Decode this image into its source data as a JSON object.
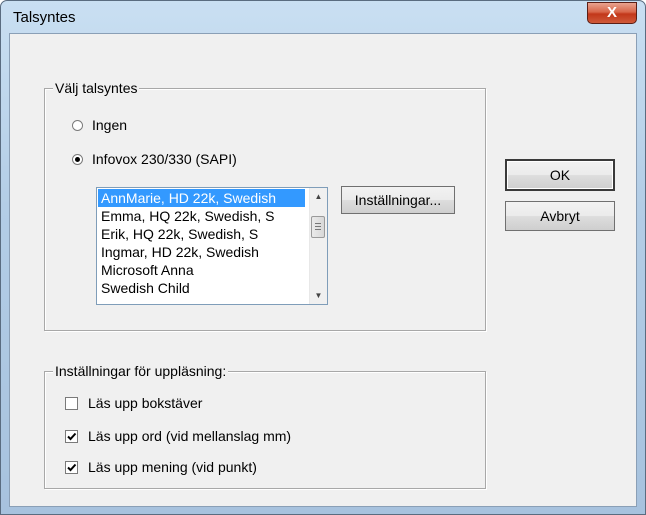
{
  "window": {
    "title": "Talsyntes",
    "close_glyph": "X"
  },
  "engine_group": {
    "label": "Välj talsyntes",
    "radio_none": {
      "label": "Ingen",
      "checked": false
    },
    "radio_infovox": {
      "label": "Infovox 230/330 (SAPI)",
      "checked": true
    },
    "voices": [
      {
        "label": "AnnMarie, HD 22k, Swedish",
        "selected": true
      },
      {
        "label": "Emma, HQ 22k, Swedish, S",
        "selected": false
      },
      {
        "label": "Erik, HQ 22k, Swedish, S",
        "selected": false
      },
      {
        "label": "Ingmar, HD 22k, Swedish",
        "selected": false
      },
      {
        "label": "Microsoft Anna",
        "selected": false
      },
      {
        "label": "Swedish Child",
        "selected": false
      }
    ],
    "settings_button": "Inställningar..."
  },
  "reading_group": {
    "label": "Inställningar för uppläsning:",
    "options": [
      {
        "label": "Läs upp bokstäver",
        "checked": false
      },
      {
        "label": "Läs upp ord (vid mellanslag mm)",
        "checked": true
      },
      {
        "label": "Läs upp mening (vid punkt)",
        "checked": true
      }
    ]
  },
  "buttons": {
    "ok": "OK",
    "cancel": "Avbryt"
  },
  "colors": {
    "selection": "#3399ff",
    "dialog_bg": "#f0f0f0",
    "close_red": "#c2371a"
  },
  "icons": {
    "scroll_up": "▲",
    "scroll_down": "▼"
  }
}
